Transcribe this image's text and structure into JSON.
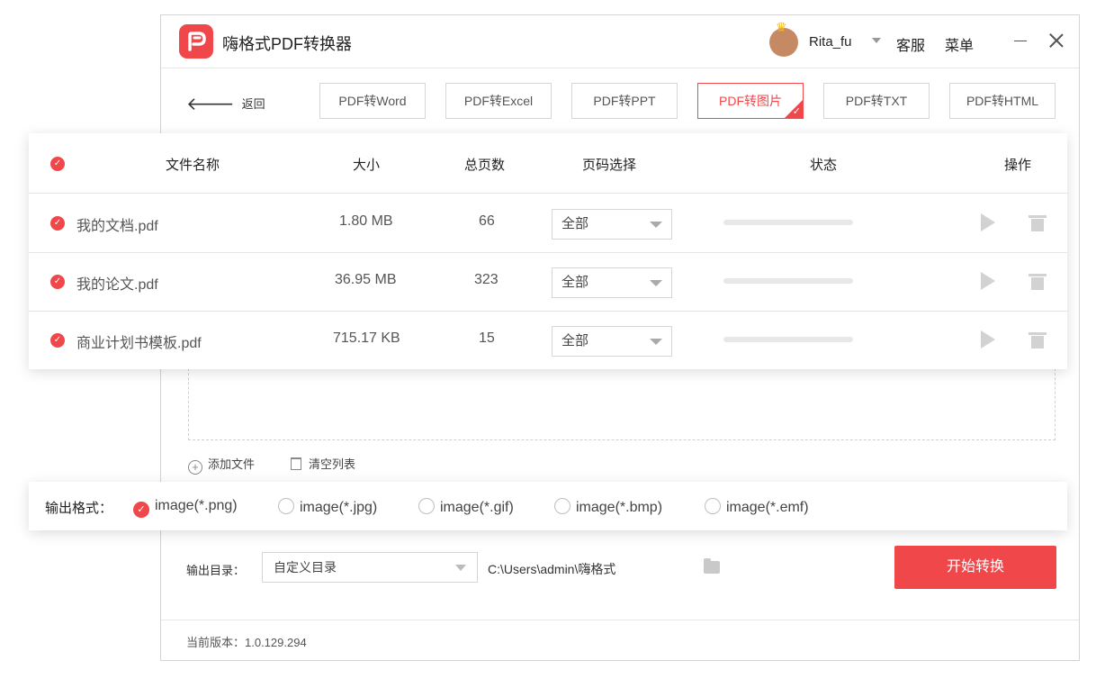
{
  "app": {
    "title": "嗨格式PDF转换器",
    "user": "Rita_fu",
    "service_label": "客服",
    "menu_label": "菜单"
  },
  "nav": {
    "back_label": "返回"
  },
  "tabs": [
    {
      "label": "PDF转Word",
      "active": false
    },
    {
      "label": "PDF转Excel",
      "active": false
    },
    {
      "label": "PDF转PPT",
      "active": false
    },
    {
      "label": "PDF转图片",
      "active": true
    },
    {
      "label": "PDF转TXT",
      "active": false
    },
    {
      "label": "PDF转HTML",
      "active": false
    }
  ],
  "table": {
    "headers": {
      "name": "文件名称",
      "size": "大小",
      "pages": "总页数",
      "page_select": "页码选择",
      "status": "状态",
      "actions": "操作"
    },
    "rows": [
      {
        "name": "我的文档.pdf",
        "size": "1.80 MB",
        "pages": "66",
        "page_select": "全部",
        "progress": 0
      },
      {
        "name": "我的论文.pdf",
        "size": "36.95 MB",
        "pages": "323",
        "page_select": "全部",
        "progress": 0
      },
      {
        "name": "商业计划书模板.pdf",
        "size": "715.17 KB",
        "pages": "15",
        "page_select": "全部",
        "progress": 0
      }
    ]
  },
  "file_actions": {
    "add_label": "添加文件",
    "clear_label": "清空列表"
  },
  "output_format": {
    "label": "输出格式：",
    "options": [
      {
        "label": "image(*.png)",
        "selected": true
      },
      {
        "label": "image(*.jpg)",
        "selected": false
      },
      {
        "label": "image(*.gif)",
        "selected": false
      },
      {
        "label": "image(*.bmp)",
        "selected": false
      },
      {
        "label": "image(*.emf)",
        "selected": false
      }
    ]
  },
  "output_dir": {
    "label": "输出目录：",
    "select_value": "自定义目录",
    "path": "C:\\Users\\admin\\嗨格式"
  },
  "start_button_label": "开始转换",
  "footer": {
    "version": "当前版本：1.0.129.294"
  },
  "colors": {
    "accent": "#f0474b"
  }
}
